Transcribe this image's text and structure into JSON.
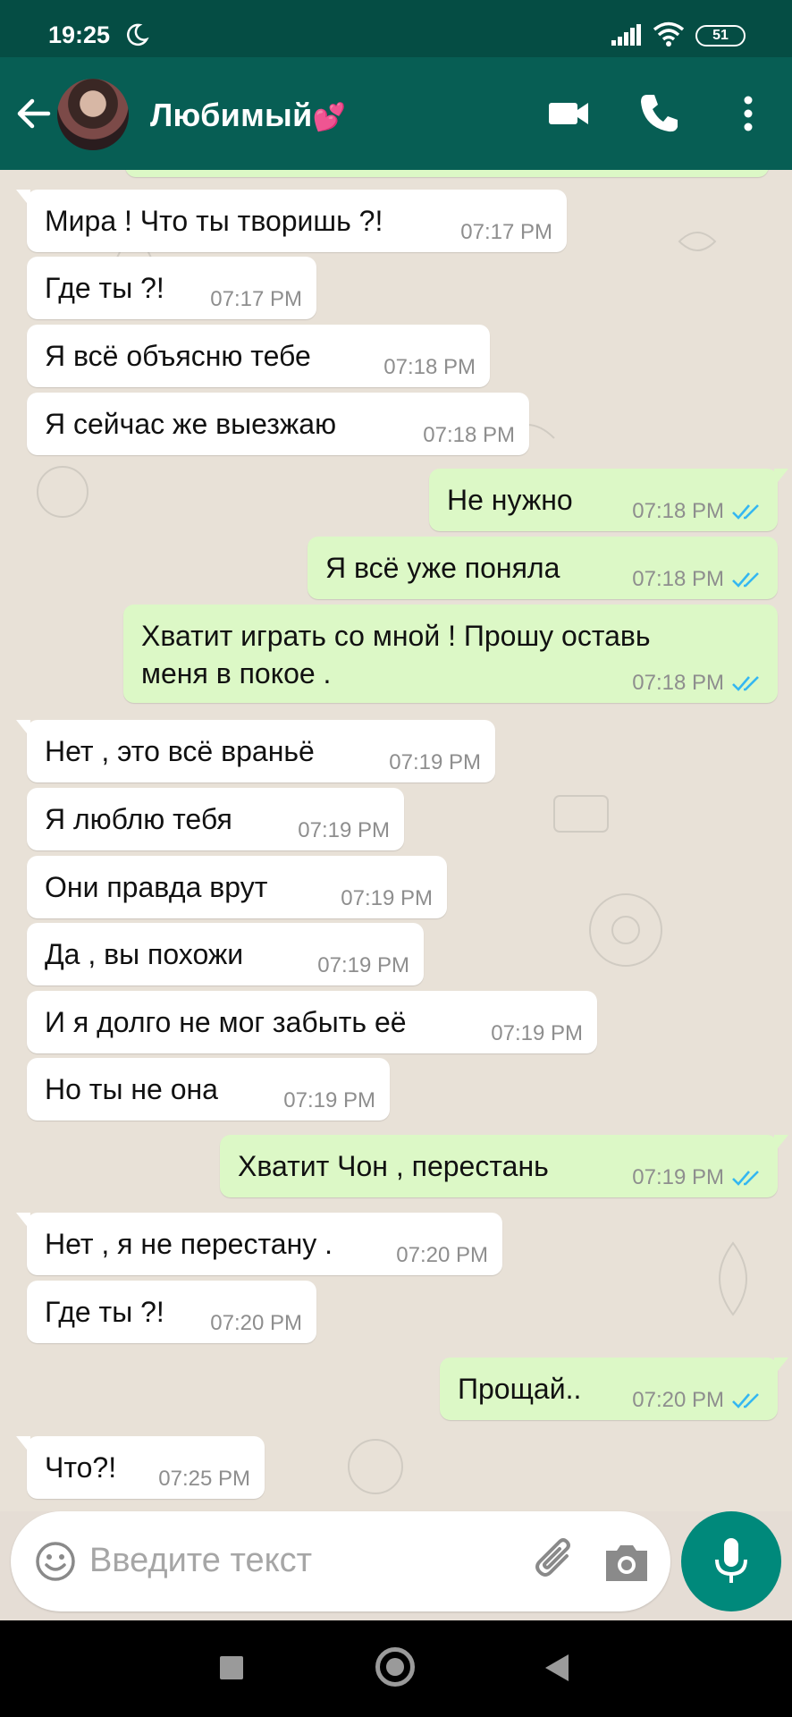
{
  "status_bar": {
    "time": "19:25",
    "battery": "51"
  },
  "header": {
    "contact_name": "Любимый",
    "contact_emoji": "💕"
  },
  "messages": [
    {
      "dir": "in",
      "text": "Мира ! Что ты творишь ?!",
      "time": "07:17 PM"
    },
    {
      "dir": "in",
      "text": "Где ты ?!",
      "time": "07:17 PM"
    },
    {
      "dir": "in",
      "text": "Я всё объясню тебе",
      "time": "07:18 PM"
    },
    {
      "dir": "in",
      "text": "Я сейчас же выезжаю",
      "time": "07:18 PM"
    },
    {
      "dir": "out",
      "text": "Не нужно",
      "time": "07:18 PM"
    },
    {
      "dir": "out",
      "text": "Я всё уже поняла",
      "time": "07:18 PM"
    },
    {
      "dir": "out",
      "text": "Хватит играть со мной ! Прошу оставь\nменя в покое .",
      "time": "07:18 PM"
    },
    {
      "dir": "in",
      "text": "Нет , это всё враньё",
      "time": "07:19 PM"
    },
    {
      "dir": "in",
      "text": "Я люблю тебя",
      "time": "07:19 PM"
    },
    {
      "dir": "in",
      "text": "Они правда врут",
      "time": "07:19 PM"
    },
    {
      "dir": "in",
      "text": "Да , вы похожи",
      "time": "07:19 PM"
    },
    {
      "dir": "in",
      "text": "И я долго не мог забыть её",
      "time": "07:19 PM"
    },
    {
      "dir": "in",
      "text": "Но ты не она",
      "time": "07:19 PM"
    },
    {
      "dir": "out",
      "text": "Хватит Чон , перестань",
      "time": "07:19 PM"
    },
    {
      "dir": "in",
      "text": "Нет , я не перестану .",
      "time": "07:20 PM"
    },
    {
      "dir": "in",
      "text": "Где ты ?!",
      "time": "07:20 PM"
    },
    {
      "dir": "out",
      "text": "Прощай..",
      "time": "07:20 PM"
    },
    {
      "dir": "in",
      "text": "Что?!",
      "time": "07:25 PM"
    }
  ],
  "input": {
    "placeholder": "Введите текст"
  },
  "colors": {
    "header": "#075e54",
    "status_bar": "#054d44",
    "outgoing_bubble": "#dcf8c6",
    "incoming_bubble": "#ffffff",
    "mic_button": "#00897b",
    "read_ticks": "#34b7f1"
  },
  "icons": [
    "back-arrow-icon",
    "video-call-icon",
    "phone-icon",
    "more-vert-icon",
    "emoji-icon",
    "attach-icon",
    "camera-icon",
    "mic-icon"
  ]
}
